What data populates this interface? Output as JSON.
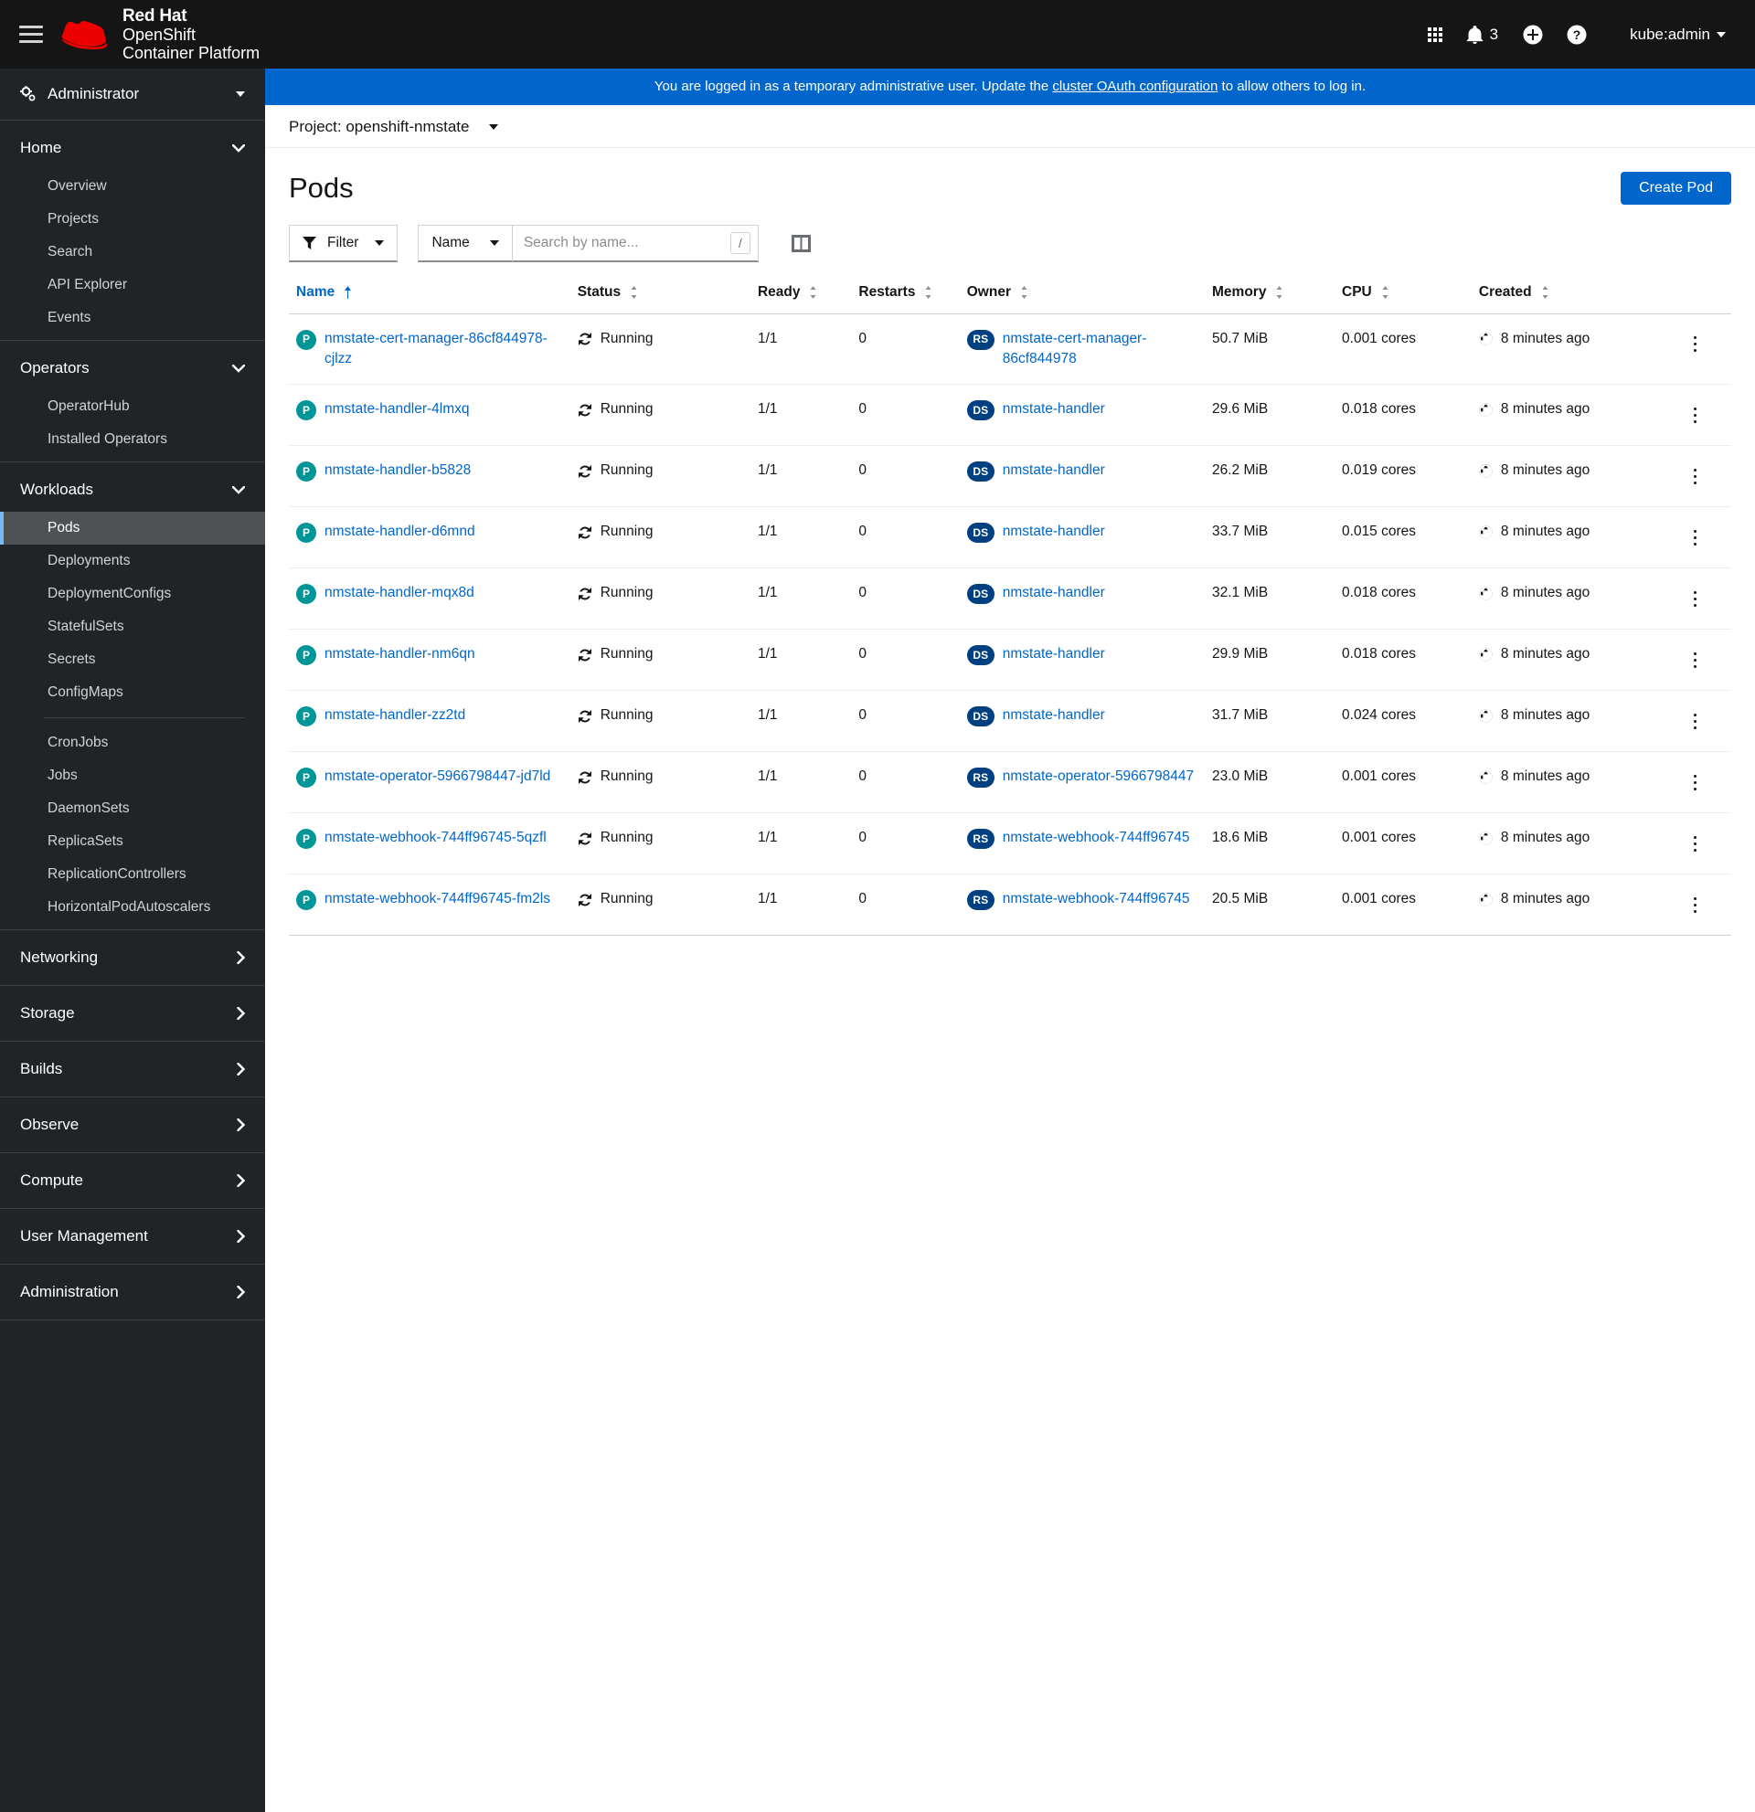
{
  "masthead": {
    "brand_line1": "Red Hat",
    "brand_line2": "OpenShift",
    "brand_line3": "Container Platform",
    "notification_count": "3",
    "user": "kube:admin"
  },
  "alert": {
    "prefix": "You are logged in as a temporary administrative user. Update the ",
    "link": "cluster OAuth configuration",
    "suffix": " to allow others to log in."
  },
  "sidebar": {
    "perspective": "Administrator",
    "sections": [
      {
        "label": "Home",
        "expanded": true,
        "items": [
          "Overview",
          "Projects",
          "Search",
          "API Explorer",
          "Events"
        ]
      },
      {
        "label": "Operators",
        "expanded": true,
        "items": [
          "OperatorHub",
          "Installed Operators"
        ]
      },
      {
        "label": "Workloads",
        "expanded": true,
        "items": [
          "Pods",
          "Deployments",
          "DeploymentConfigs",
          "StatefulSets",
          "Secrets",
          "ConfigMaps",
          "CronJobs",
          "Jobs",
          "DaemonSets",
          "ReplicaSets",
          "ReplicationControllers",
          "HorizontalPodAutoscalers"
        ],
        "active": "Pods",
        "divider_after": "ConfigMaps"
      }
    ],
    "collapsed": [
      "Networking",
      "Storage",
      "Builds",
      "Observe",
      "Compute",
      "User Management",
      "Administration"
    ]
  },
  "project": {
    "label": "Project: openshift-nmstate"
  },
  "page": {
    "title": "Pods",
    "create_button": "Create Pod"
  },
  "toolbar": {
    "filter_label": "Filter",
    "attribute_label": "Name",
    "search_placeholder": "Search by name...",
    "search_value": "",
    "search_shortcut": "/"
  },
  "table": {
    "columns": [
      "Name",
      "Status",
      "Ready",
      "Restarts",
      "Owner",
      "Memory",
      "CPU",
      "Created"
    ],
    "sorted_column": "Name",
    "sort_direction": "asc",
    "rows": [
      {
        "name": "nmstate-cert-manager-86cf844978-cjlzz",
        "status": "Running",
        "ready": "1/1",
        "restarts": "0",
        "owner": "nmstate-cert-manager-86cf844978",
        "owner_kind": "RS",
        "memory": "50.7 MiB",
        "cpu": "0.001 cores",
        "created": "8 minutes ago"
      },
      {
        "name": "nmstate-handler-4lmxq",
        "status": "Running",
        "ready": "1/1",
        "restarts": "0",
        "owner": "nmstate-handler",
        "owner_kind": "DS",
        "memory": "29.6 MiB",
        "cpu": "0.018 cores",
        "created": "8 minutes ago"
      },
      {
        "name": "nmstate-handler-b5828",
        "status": "Running",
        "ready": "1/1",
        "restarts": "0",
        "owner": "nmstate-handler",
        "owner_kind": "DS",
        "memory": "26.2 MiB",
        "cpu": "0.019 cores",
        "created": "8 minutes ago"
      },
      {
        "name": "nmstate-handler-d6mnd",
        "status": "Running",
        "ready": "1/1",
        "restarts": "0",
        "owner": "nmstate-handler",
        "owner_kind": "DS",
        "memory": "33.7 MiB",
        "cpu": "0.015 cores",
        "created": "8 minutes ago"
      },
      {
        "name": "nmstate-handler-mqx8d",
        "status": "Running",
        "ready": "1/1",
        "restarts": "0",
        "owner": "nmstate-handler",
        "owner_kind": "DS",
        "memory": "32.1 MiB",
        "cpu": "0.018 cores",
        "created": "8 minutes ago"
      },
      {
        "name": "nmstate-handler-nm6qn",
        "status": "Running",
        "ready": "1/1",
        "restarts": "0",
        "owner": "nmstate-handler",
        "owner_kind": "DS",
        "memory": "29.9 MiB",
        "cpu": "0.018 cores",
        "created": "8 minutes ago"
      },
      {
        "name": "nmstate-handler-zz2td",
        "status": "Running",
        "ready": "1/1",
        "restarts": "0",
        "owner": "nmstate-handler",
        "owner_kind": "DS",
        "memory": "31.7 MiB",
        "cpu": "0.024 cores",
        "created": "8 minutes ago"
      },
      {
        "name": "nmstate-operator-5966798447-jd7ld",
        "status": "Running",
        "ready": "1/1",
        "restarts": "0",
        "owner": "nmstate-operator-5966798447",
        "owner_kind": "RS",
        "memory": "23.0 MiB",
        "cpu": "0.001 cores",
        "created": "8 minutes ago"
      },
      {
        "name": "nmstate-webhook-744ff96745-5qzfl",
        "status": "Running",
        "ready": "1/1",
        "restarts": "0",
        "owner": "nmstate-webhook-744ff96745",
        "owner_kind": "RS",
        "memory": "18.6 MiB",
        "cpu": "0.001 cores",
        "created": "8 minutes ago"
      },
      {
        "name": "nmstate-webhook-744ff96745-fm2ls",
        "status": "Running",
        "ready": "1/1",
        "restarts": "0",
        "owner": "nmstate-webhook-744ff96745",
        "owner_kind": "RS",
        "memory": "20.5 MiB",
        "cpu": "0.001 cores",
        "created": "8 minutes ago"
      }
    ]
  },
  "colors": {
    "brand_red": "#ee0000",
    "accent_blue": "#0066cc",
    "link_blue": "#06c",
    "pod_badge": "#009596",
    "owner_badge": "#004080"
  }
}
